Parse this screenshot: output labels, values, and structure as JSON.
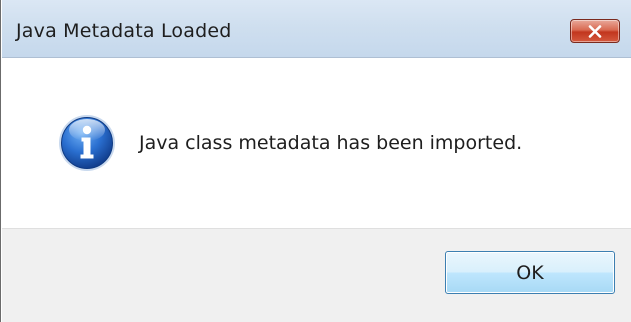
{
  "window": {
    "title": "Java Metadata Loaded",
    "close_icon": "close-icon"
  },
  "content": {
    "icon": "info-icon",
    "message": "Java class metadata has been imported."
  },
  "footer": {
    "ok_label": "OK"
  },
  "colors": {
    "titlebar": "#cfdfef",
    "close_button": "#c2361e",
    "info_icon": "#1f5bb8",
    "footer_background": "#f0f0f0",
    "ok_button_border": "#3c7fb1"
  }
}
